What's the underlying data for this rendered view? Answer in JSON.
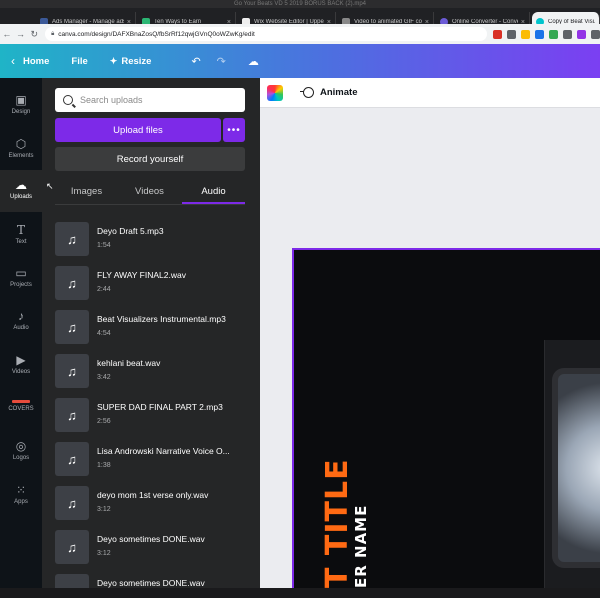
{
  "window": {
    "title": "Go Your Beats VD 5 2019 BORUS BACK (2).mp4"
  },
  "browser": {
    "tabs": [
      {
        "label": "Ads Manager - Manage ads",
        "color": "#3b5998"
      },
      {
        "label": "Ten Ways to Earn",
        "color": "#2bb673"
      },
      {
        "label": "Wix Website Editor | Uppers",
        "color": "#222222"
      },
      {
        "label": "Video to animated GIF conv",
        "color": "#888888"
      },
      {
        "label": "Online Converter - Convert",
        "color": "#6b5bd6"
      },
      {
        "label": "Copy of Beat Visualiz",
        "color": "#00c4cc"
      }
    ],
    "url": "canva.com/design/DAFXBnaZosQ/fbSrRf12qwjGVnQ0oWZwKg/edit"
  },
  "canva": {
    "topbar": {
      "home": "Home",
      "file": "File",
      "resize": "Resize"
    },
    "rail": [
      {
        "label": "Design",
        "icon": "design-icon"
      },
      {
        "label": "Elements",
        "icon": "elements-icon"
      },
      {
        "label": "Uploads",
        "icon": "uploads-icon",
        "active": true
      },
      {
        "label": "Text",
        "icon": "text-icon"
      },
      {
        "label": "Projects",
        "icon": "projects-icon"
      },
      {
        "label": "Audio",
        "icon": "audio-icon"
      },
      {
        "label": "Videos",
        "icon": "videos-icon"
      },
      {
        "label": "COVERS",
        "icon": "covers-icon"
      },
      {
        "label": "Logos",
        "icon": "logos-icon"
      },
      {
        "label": "Apps",
        "icon": "apps-icon"
      }
    ],
    "uploads": {
      "search_placeholder": "Search uploads",
      "upload_label": "Upload files",
      "more_label": "•••",
      "record_label": "Record yourself",
      "tabs": [
        "Images",
        "Videos",
        "Audio"
      ],
      "active_tab": "Audio",
      "files": [
        {
          "name": "Deyo Draft 5.mp3",
          "duration": "1:54"
        },
        {
          "name": "FLY AWAY FINAL2.wav",
          "duration": "2:44"
        },
        {
          "name": "Beat Visualizers Instrumental.mp3",
          "duration": "4:54"
        },
        {
          "name": "kehlani beat.wav",
          "duration": "3:42"
        },
        {
          "name": "SUPER DAD FINAL PART 2.mp3",
          "duration": "2:56"
        },
        {
          "name": "Lisa Androwski Narrative Voice O...",
          "duration": "1:38"
        },
        {
          "name": "deyo mom 1st verse only.wav",
          "duration": "3:12"
        },
        {
          "name": "Deyo sometimes DONE.wav",
          "duration": "3:12"
        },
        {
          "name": "Deyo sometimes DONE.wav",
          "duration": ""
        }
      ]
    },
    "editor": {
      "animate_label": "Animate",
      "design_title": "T TITLE",
      "design_subtitle": "ER NAME"
    }
  }
}
